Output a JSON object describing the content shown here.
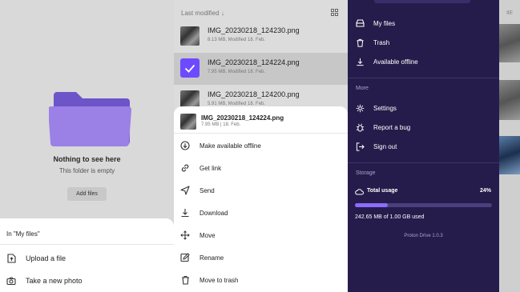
{
  "colors": {
    "accent": "#6d4aff",
    "drawer_bg": "#261c4b",
    "folder": "#8b6fd6"
  },
  "empty_folder": {
    "title": "Nothing to see here",
    "subtitle": "This folder is empty",
    "add_button": "Add files"
  },
  "upload_sheet": {
    "header": "In \"My files\"",
    "items": [
      {
        "label": "Upload a file",
        "icon": "upload-file-icon"
      },
      {
        "label": "Take a new photo",
        "icon": "camera-icon"
      }
    ]
  },
  "file_list": {
    "sort_label": "Last modified",
    "files": [
      {
        "name": "IMG_20230218_124230.png",
        "meta": "8.13 MB, Modified 18. Feb."
      },
      {
        "name": "IMG_20230218_124224.png",
        "meta": "7.95 MB, Modified 18. Feb.",
        "selected": true
      },
      {
        "name": "IMG_20230218_124200.png",
        "meta": "5.91 MB, Modified 18. Feb."
      }
    ]
  },
  "actions_sheet": {
    "file_name": "IMG_20230218_124224.png",
    "file_meta": "7.95 MB | 18. Feb.",
    "items": [
      {
        "label": "Make available offline",
        "icon": "offline-download-icon"
      },
      {
        "label": "Get link",
        "icon": "link-icon"
      },
      {
        "label": "Send",
        "icon": "send-icon"
      },
      {
        "label": "Download",
        "icon": "download-icon"
      },
      {
        "label": "Move",
        "icon": "move-icon"
      },
      {
        "label": "Rename",
        "icon": "rename-icon"
      },
      {
        "label": "Move to trash",
        "icon": "trash-icon"
      }
    ]
  },
  "drawer": {
    "nav": [
      {
        "label": "My files",
        "icon": "drive-icon"
      },
      {
        "label": "Trash",
        "icon": "trash-icon"
      },
      {
        "label": "Available offline",
        "icon": "download-icon"
      }
    ],
    "more_header": "More",
    "more": [
      {
        "label": "Settings",
        "icon": "gear-icon"
      },
      {
        "label": "Report a bug",
        "icon": "bug-icon"
      },
      {
        "label": "Sign out",
        "icon": "sign-out-icon"
      }
    ],
    "storage_header": "Storage",
    "usage_title": "Total usage",
    "usage_percent": "24%",
    "usage_fraction": 0.24,
    "usage_text": "242.65 MB of 1.00 GB used",
    "version": "Proton Drive 1.0.3"
  },
  "background_sort_label": "ⅡE"
}
